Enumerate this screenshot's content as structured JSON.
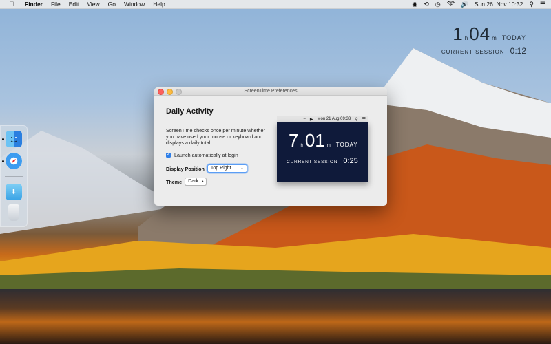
{
  "menubar": {
    "apple_icon": "apple-icon",
    "items": [
      "Finder",
      "File",
      "Edit",
      "View",
      "Go",
      "Window",
      "Help"
    ],
    "status_icons": [
      "eye-icon",
      "clock-arrow-icon",
      "timer-icon",
      "wifi-icon",
      "volume-icon"
    ],
    "datetime": "Sun 26. Nov  10:32",
    "search_icon": "search-icon",
    "list_icon": "list-icon"
  },
  "desktop_clock": {
    "hours": "1",
    "h_unit": "h",
    "minutes": "04",
    "m_unit": "m",
    "today_label": "TODAY",
    "session_label": "CURRENT SESSION",
    "session_value": "0:12"
  },
  "dock": {
    "items": [
      "finder-icon",
      "safari-icon",
      "downloads-folder-icon",
      "trash-icon"
    ]
  },
  "window": {
    "title": "ScreenTime Preferences",
    "heading": "Daily Activity",
    "description": "ScreenTime checks once per minute whether you have used your mouse or keyboard and displays a daily total.",
    "launch_label": "Launch automatically at login",
    "launch_checked": true,
    "position_label": "Display Position",
    "position_value": "Top Right",
    "theme_label": "Theme",
    "theme_value": "Dark",
    "preview": {
      "menubar_date": "Mon 21 Aug  09:33",
      "hours": "7",
      "h_unit": "h",
      "minutes": "01",
      "m_unit": "m",
      "today_label": "TODAY",
      "session_label": "CURRENT SESSION",
      "session_value": "0:25"
    }
  },
  "colors": {
    "accent": "#2f7fe8",
    "preview_bg": "#0f1a3a",
    "close": "#fc605c",
    "minimize": "#fdbc40"
  }
}
